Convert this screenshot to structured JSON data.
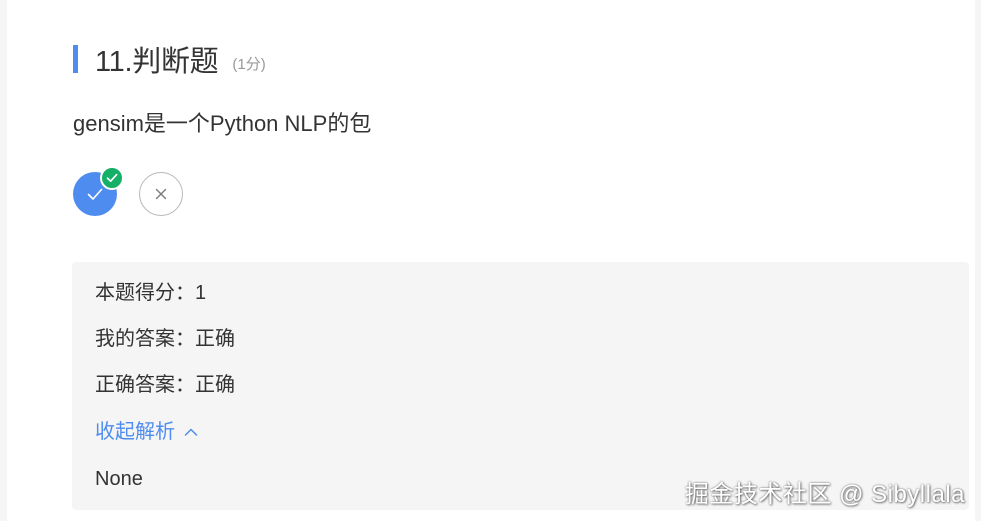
{
  "question": {
    "title": "11.判断题",
    "score": "(1分)",
    "stem": "gensim是一个Python NLP的包"
  },
  "options": {
    "true_icon": "check-icon",
    "false_icon": "close-icon",
    "selected_badge_icon": "check-badge-icon"
  },
  "analysis": {
    "score_label": "本题得分：",
    "score_value": "1",
    "my_answer_label": "我的答案：",
    "my_answer_value": "正确",
    "correct_answer_label": "正确答案：",
    "correct_answer_value": "正确",
    "toggle_label": "收起解析",
    "toggle_icon": "chevron-up-icon",
    "body": "None"
  },
  "watermark": "掘金技术社区 @ Sibyllala",
  "colors": {
    "accent": "#4f8cf0",
    "correct_badge": "#15b067",
    "panel_bg": "#f5f5f5",
    "text": "#333333",
    "muted": "#999999"
  }
}
